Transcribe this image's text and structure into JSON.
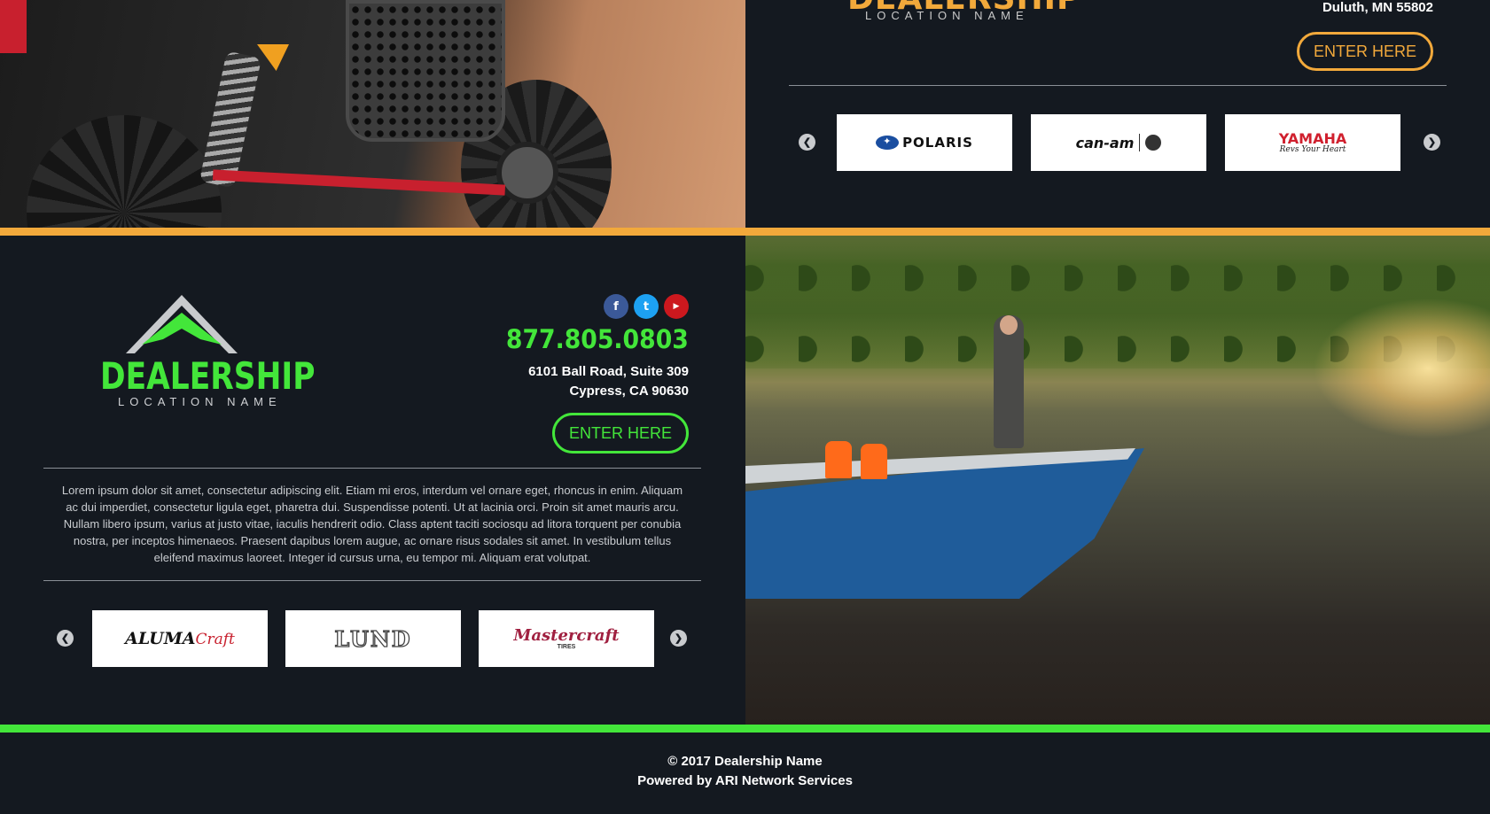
{
  "top": {
    "logo_word": "DEALERSHIP",
    "logo_sub": "LOCATION NAME",
    "address_line": "Duluth, MN 55802",
    "enter_label": "ENTER HERE",
    "brands": [
      "POLARIS",
      "can-am",
      "YAMAHA"
    ],
    "yamaha_tagline": "Revs Your Heart"
  },
  "middle": {
    "logo_word": "DEALERSHIP",
    "logo_sub": "LOCATION NAME",
    "social": [
      "facebook",
      "twitter",
      "youtube"
    ],
    "phone": "877.805.0803",
    "address_line1": "6101 Ball Road, Suite 309",
    "address_line2": "Cypress, CA 90630",
    "enter_label": "ENTER HERE",
    "description": "Lorem ipsum dolor sit amet, consectetur adipiscing elit. Etiam mi eros, interdum vel ornare eget, rhoncus in enim. Aliquam ac dui imperdiet, consectetur ligula eget, pharetra dui. Suspendisse potenti. Ut at lacinia orci. Proin sit amet mauris arcu. Nullam libero ipsum, varius at justo vitae, iaculis hendrerit odio. Class aptent taciti sociosqu ad litora torquent per conubia nostra, per inceptos himenaeos. Praesent dapibus lorem augue, ac ornare risus sodales sit amet. In vestibulum tellus eleifend maximus laoreet. Integer id cursus urna, eu tempor mi. Aliquam erat volutpat.",
    "brands": [
      "ALUMA",
      "Craft",
      "LUND",
      "Mastercraft",
      "TIRES"
    ]
  },
  "footer": {
    "copyright": "© 2017 Dealership Name",
    "powered_by": "Powered by ARI Network Services"
  },
  "colors": {
    "background": "#141920",
    "accent_orange": "#f2a93b",
    "accent_green": "#43e63a",
    "facebook": "#3b5998",
    "twitter": "#1da1f2",
    "youtube": "#cc181e"
  },
  "icons": {
    "arrow_left": "chevron-left-icon",
    "arrow_right": "chevron-right-icon"
  }
}
